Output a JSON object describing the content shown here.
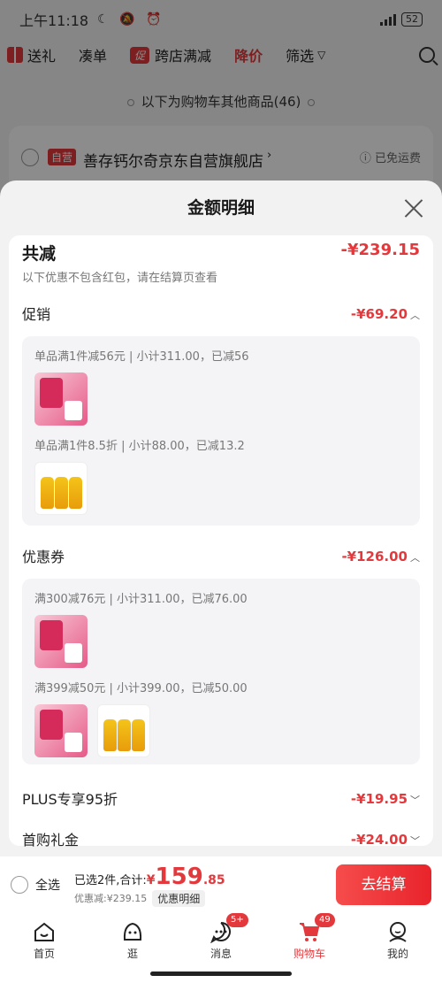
{
  "status": {
    "time": "上午11:18",
    "battery": "52"
  },
  "filter": {
    "gift": "送礼",
    "bundle": "凑单",
    "cut_badge": "促",
    "cross_store": "跨店满减",
    "price_drop": "降价",
    "filter": "筛选"
  },
  "divider": "以下为购物车其他商品(46)",
  "shop": {
    "badge": "自营",
    "name": "善存钙尔奇京东自营旗舰店",
    "free_shipping": "已免运费"
  },
  "sheet": {
    "title": "金额明细",
    "total_label": "共减",
    "total_amount": "-¥239.15",
    "note": "以下优惠不包含红包，请在结算页查看",
    "promo": {
      "label": "促销",
      "amount": "-¥69.20",
      "lines": [
        "单品满1件减56元 | 小计311.00，已减56",
        "单品满1件8.5折 | 小计88.00，已减13.2"
      ]
    },
    "coupon": {
      "label": "优惠券",
      "amount": "-¥126.00",
      "lines": [
        "满300减76元 | 小计311.00，已减76.00",
        "满399减50元 | 小计399.00，已减50.00"
      ]
    },
    "plus": {
      "label": "PLUS专享95折",
      "amount": "-¥19.95"
    },
    "first": {
      "label": "首购礼金",
      "amount": "-¥24.00"
    }
  },
  "checkout": {
    "select_all": "全选",
    "selected": "已选2件,合计:",
    "currency": "¥",
    "price_int": "159",
    "price_dec": ".85",
    "discount": "优惠减:¥239.15",
    "detail": "优惠明细",
    "pay": "去结算"
  },
  "tabs": [
    {
      "label": "首页",
      "icon": "home-icon"
    },
    {
      "label": "逛",
      "icon": "browse-icon"
    },
    {
      "label": "消息",
      "icon": "message-icon",
      "badge": "5+"
    },
    {
      "label": "购物车",
      "icon": "cart-icon",
      "badge": "49"
    },
    {
      "label": "我的",
      "icon": "profile-icon"
    }
  ],
  "colors": {
    "accent": "#e4393c"
  }
}
